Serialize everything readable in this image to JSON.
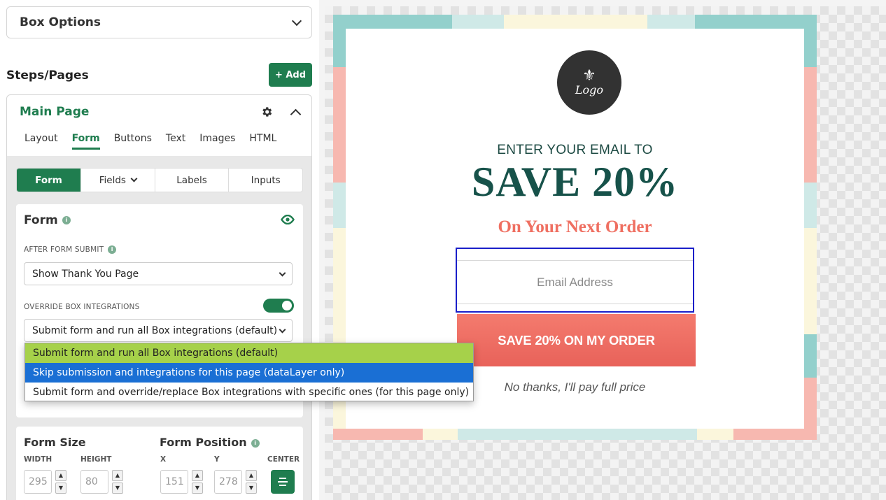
{
  "sidebar": {
    "box_options": {
      "title": "Box Options"
    },
    "steps": {
      "title": "Steps/Pages",
      "add_label": "+ Add"
    },
    "page": {
      "name": "Main Page",
      "tabs": [
        "Layout",
        "Form",
        "Buttons",
        "Text",
        "Images",
        "HTML"
      ],
      "active_tab": "Form",
      "subtabs": [
        "Form",
        "Fields",
        "Labels",
        "Inputs"
      ],
      "active_subtab": "Form"
    },
    "form_section": {
      "title": "Form",
      "after_submit_label": "AFTER FORM SUBMIT",
      "after_submit_value": "Show Thank You Page",
      "override_label": "OVERRIDE BOX INTEGRATIONS",
      "override_enabled": true,
      "override_value": "Submit form and run all Box integrations (default)"
    },
    "dropdown_options": [
      "Submit form and run all Box integrations (default)",
      "Skip submission and integrations for this page (dataLayer only)",
      "Submit form and override/replace Box integrations with specific ones (for this page only)"
    ],
    "size_section": {
      "size_title": "Form Size",
      "position_title": "Form Position",
      "width_label": "WIDTH",
      "height_label": "HEIGHT",
      "x_label": "X",
      "y_label": "Y",
      "center_label": "CENTER",
      "width": "295",
      "height": "80",
      "x": "151",
      "y": "278"
    }
  },
  "popup": {
    "logo_text": "Logo",
    "line1": "ENTER YOUR EMAIL TO",
    "line2": "SAVE 20%",
    "line3": "On Your Next Order",
    "email_placeholder": "Email Address",
    "cta": "SAVE 20% ON MY ORDER",
    "decline": "No thanks, I'll pay full price"
  },
  "colors": {
    "accent_green": "#1f7d4f",
    "headline_teal": "#17524a",
    "coral": "#ef6f61",
    "option_highlight": "#a6d14a",
    "option_selected": "#1a6fd4",
    "frame_teal": "#93d0cc",
    "frame_pink": "#f7b8b0",
    "frame_cream": "#fbf6dc"
  }
}
